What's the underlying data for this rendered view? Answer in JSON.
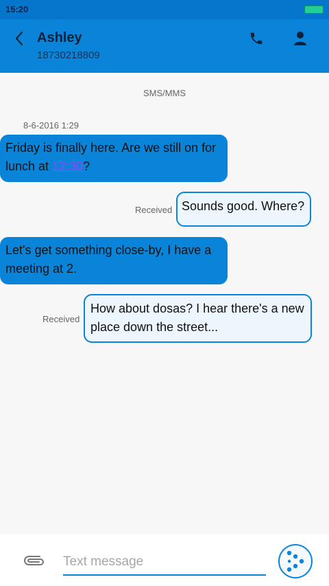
{
  "status_bar": {
    "time": "15:20"
  },
  "header": {
    "contact_name": "Ashley",
    "contact_number": "18730218809",
    "back_icon": "chevron-left-icon",
    "call_icon": "phone-icon",
    "profile_icon": "person-icon"
  },
  "thread": {
    "channel_label": "SMS/MMS",
    "timestamp": "8-6-2016 1:29",
    "messages": [
      {
        "direction": "incoming",
        "text_before_link": "Friday is finally here. Are we still on for lunch at ",
        "link": "12:30",
        "text_after_link": "?"
      },
      {
        "direction": "outgoing",
        "status": "Received",
        "text": "Sounds good. Where?"
      },
      {
        "direction": "incoming",
        "text": "Let's get something close-by, I have a meeting at 2."
      },
      {
        "direction": "outgoing",
        "status": "Received",
        "text": "How about dosas? I hear there's a new place down the street..."
      }
    ]
  },
  "composer": {
    "placeholder": "Text message",
    "attach_icon": "paperclip-icon",
    "send_icon": "send-icon"
  },
  "colors": {
    "accent": "#0a84d8",
    "status_bar": "#0676cc",
    "link": "#a53bff",
    "outgoing_bubble": "#edf5fd",
    "background": "#f7f7f7",
    "battery": "#1fcf95"
  }
}
